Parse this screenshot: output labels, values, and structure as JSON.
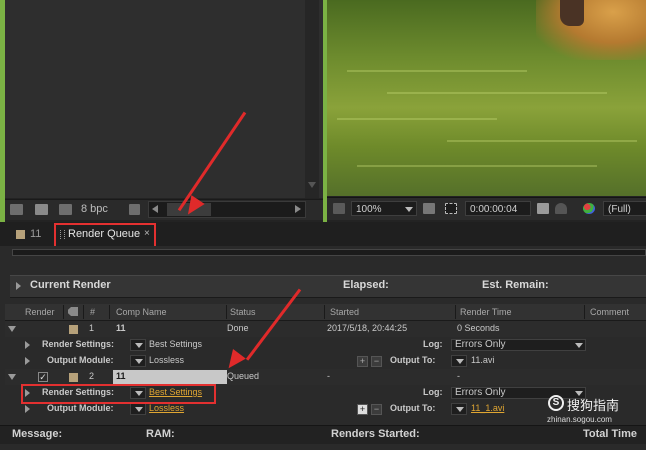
{
  "project_panel": {
    "bpc_label": "8 bpc"
  },
  "viewer": {
    "zoom": "100%",
    "timecode": "0:00:00:04",
    "resolution": "(Full)"
  },
  "tabs": [
    {
      "label": "11"
    },
    {
      "label": "Render Queue"
    }
  ],
  "render_queue": {
    "current_render_label": "Current Render",
    "elapsed_label": "Elapsed:",
    "est_remain_label": "Est. Remain:",
    "columns": [
      "Render",
      "#",
      "Comp Name",
      "Status",
      "Started",
      "Render Time",
      "Comment"
    ],
    "items": [
      {
        "index": "1",
        "comp_name": "11",
        "status": "Done",
        "started": "2017/5/18, 20:44:25",
        "render_time": "0 Seconds",
        "render_settings_label": "Render Settings:",
        "render_settings_value": "Best Settings",
        "output_module_label": "Output Module:",
        "output_module_value": "Lossless",
        "log_label": "Log:",
        "log_value": "Errors Only",
        "output_to_label": "Output To:",
        "output_to_value": "11.avi"
      },
      {
        "index": "2",
        "comp_name": "11",
        "status": "Queued",
        "started": "-",
        "render_time": "-",
        "render_settings_label": "Render Settings:",
        "render_settings_value": "Best Settings",
        "output_module_label": "Output Module:",
        "output_module_value": "Lossless",
        "log_label": "Log:",
        "log_value": "Errors Only",
        "output_to_label": "Output To:",
        "output_to_value": "11_1.avi"
      }
    ]
  },
  "status_bar": {
    "message_label": "Message:",
    "ram_label": "RAM:",
    "renders_started_label": "Renders Started:",
    "total_time_label": "Total Time"
  },
  "watermark": {
    "main": "搜狗指南",
    "sub": "zhinan.sogou.com"
  },
  "colors": {
    "accent_red": "#e33030",
    "link_orange": "#e0a632",
    "label_swatch": "#b6a17a"
  }
}
